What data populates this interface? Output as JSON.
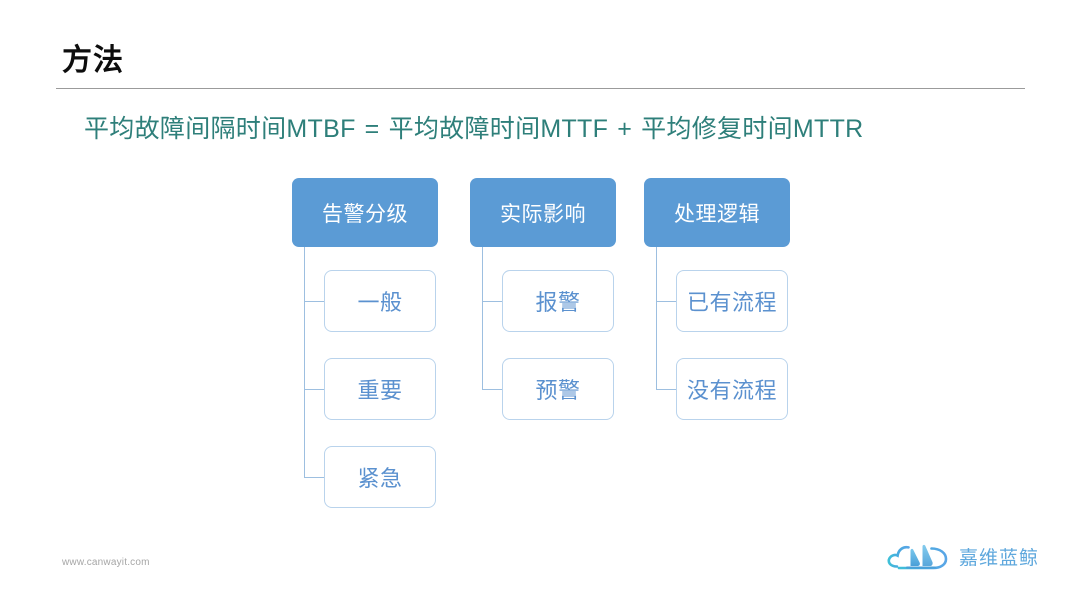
{
  "slide": {
    "title": "方法",
    "background_color": "#ffffff"
  },
  "formula": {
    "left": "平均故障间隔时间MTBF",
    "operator_equals": "=",
    "middle": "平均故障时间MTTF",
    "operator_plus": "+",
    "right": "平均修复时间MTTR",
    "color": "#2e7f7a"
  },
  "diagram": {
    "header_color": "#5b9bd5",
    "child_border_color": "#b9d3ec",
    "child_text_color": "#5b91cf",
    "connector_color": "#9dbfe0",
    "columns": [
      {
        "header": "告警分级",
        "children": [
          "一般",
          "重要",
          "紧急"
        ]
      },
      {
        "header": "实际影响",
        "children": [
          "报警",
          "预警"
        ]
      },
      {
        "header": "处理逻辑",
        "children": [
          "已有流程",
          "没有流程"
        ]
      }
    ]
  },
  "footer": {
    "url": "www.canwayit.com",
    "logo_text": "嘉维蓝鲸",
    "logo_icon": "cloud-whale-logo-icon",
    "logo_color": "#5fa8dd"
  }
}
